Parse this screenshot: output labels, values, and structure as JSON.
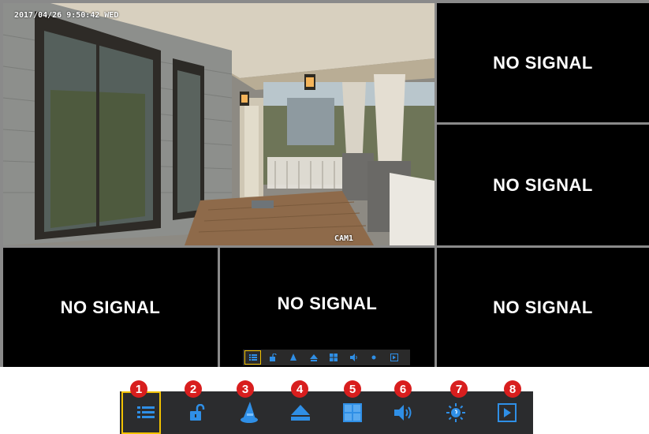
{
  "camera": {
    "timestamp": "2017/04/26 9:50:42 WED",
    "label": "CAM1"
  },
  "tiles": {
    "no_signal": "NO SIGNAL"
  },
  "toolbar": {
    "accent": "#2f8fe6",
    "selected_color": "#f2c200",
    "items": [
      {
        "number": "1",
        "icon": "main-menu-icon"
      },
      {
        "number": "2",
        "icon": "unlock-icon"
      },
      {
        "number": "3",
        "icon": "wizard-hat-icon"
      },
      {
        "number": "4",
        "icon": "up-arrow-icon"
      },
      {
        "number": "5",
        "icon": "split-screen-icon"
      },
      {
        "number": "6",
        "icon": "volume-icon"
      },
      {
        "number": "7",
        "icon": "brightness-icon"
      },
      {
        "number": "8",
        "icon": "playback-icon"
      }
    ]
  }
}
